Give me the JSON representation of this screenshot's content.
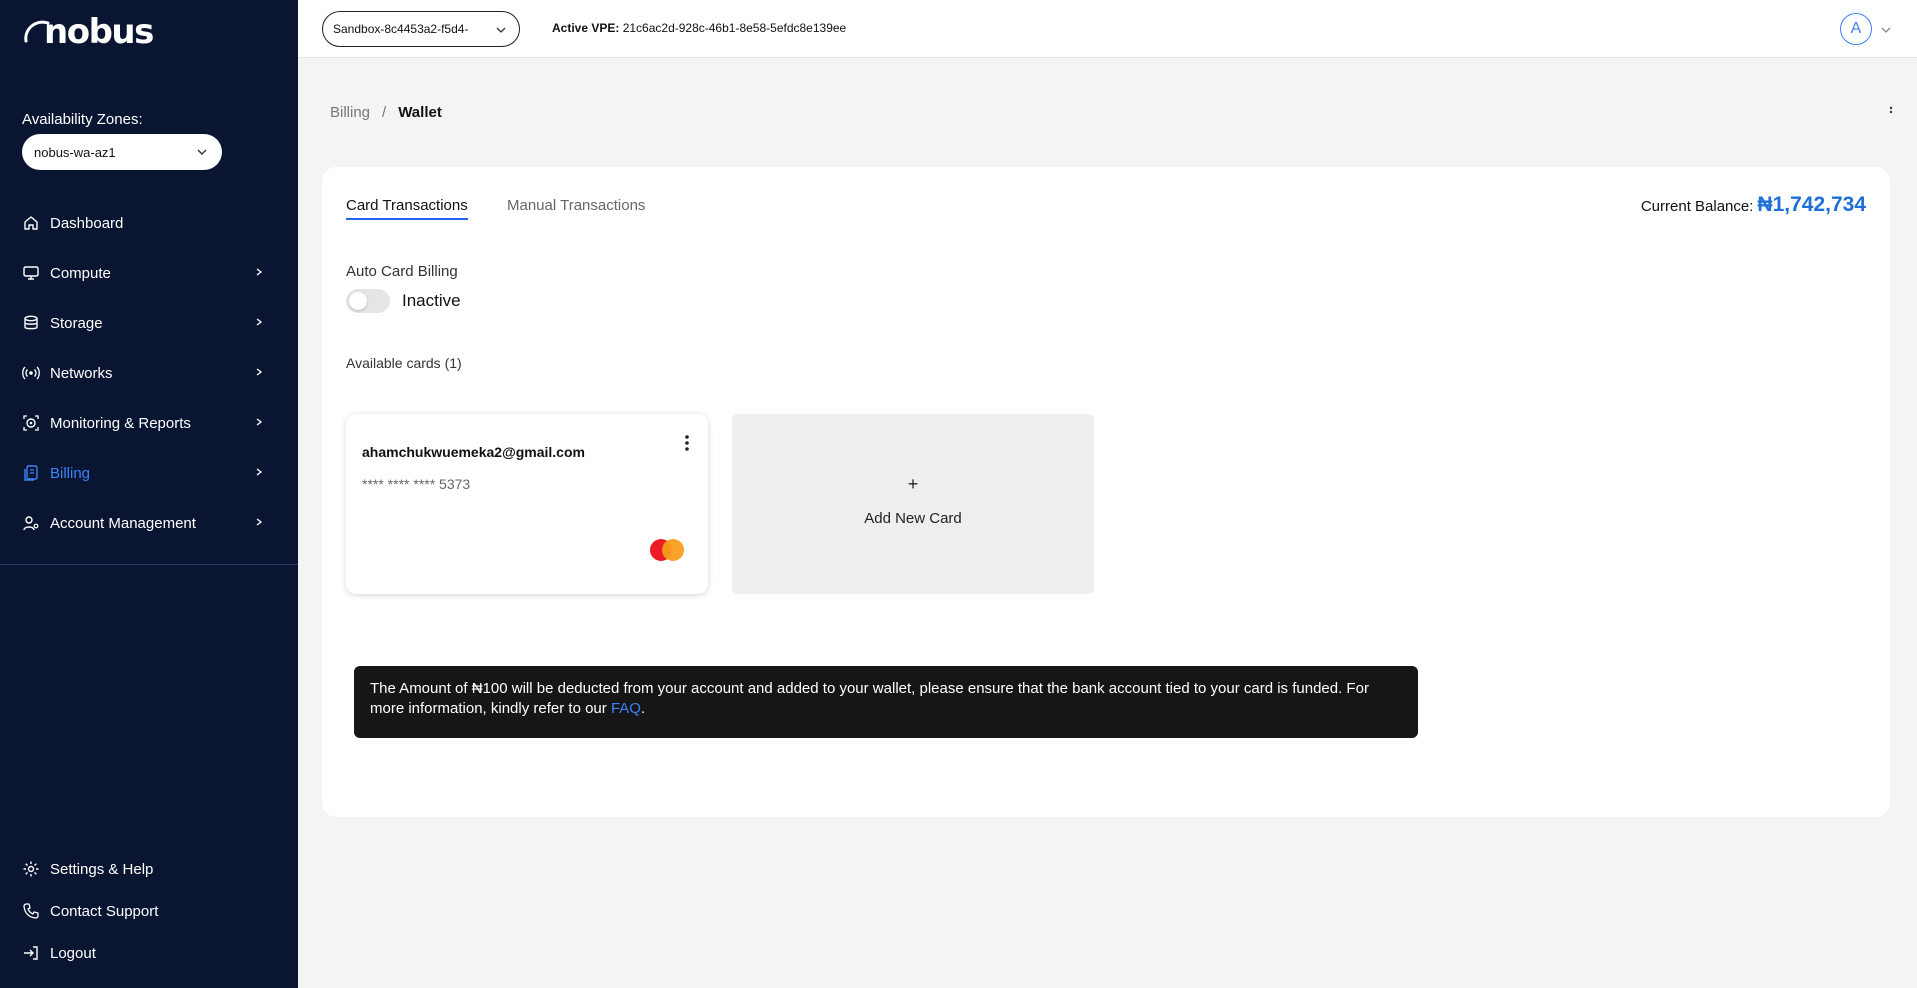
{
  "brand": {
    "name": "nobus"
  },
  "sidebar": {
    "az_label": "Availability Zones:",
    "az_value": "nobus-wa-az1",
    "items": [
      {
        "label": "Dashboard",
        "icon": "home-icon"
      },
      {
        "label": "Compute",
        "icon": "monitor-icon"
      },
      {
        "label": "Storage",
        "icon": "database-icon"
      },
      {
        "label": "Networks",
        "icon": "network-icon"
      },
      {
        "label": "Monitoring & Reports",
        "icon": "monitoring-icon"
      },
      {
        "label": "Billing",
        "icon": "billing-icon"
      },
      {
        "label": "Account Management",
        "icon": "user-settings-icon"
      }
    ],
    "bottom_items": [
      {
        "label": "Settings & Help",
        "icon": "gear-icon"
      },
      {
        "label": "Contact Support",
        "icon": "phone-icon"
      },
      {
        "label": "Logout",
        "icon": "logout-icon"
      }
    ]
  },
  "topbar": {
    "vpe_select": "Sandbox-8c4453a2-f5d4-",
    "active_vpe_label": "Active VPE:",
    "active_vpe_value": "21c6ac2d-928c-46b1-8e58-5efdc8e139ee",
    "avatar_initial": "A"
  },
  "breadcrumb": {
    "parent": "Billing",
    "separator": "/",
    "current": "Wallet"
  },
  "wallet": {
    "tabs": [
      "Card Transactions",
      "Manual Transactions"
    ],
    "balance_label": "Current Balance:",
    "balance_value": "₦1,742,734",
    "auto_billing_label": "Auto Card Billing",
    "auto_billing_state": "Inactive",
    "available_cards_label": "Available cards (1)",
    "card": {
      "email": "ahamchukwuemeka2@gmail.com",
      "number": "**** **** **** 5373"
    },
    "add_card_label": "Add New Card",
    "notice_text": "The Amount of ₦100 will be deducted from your account and added to your wallet, please ensure that the bank account tied to your card is funded. For more information, kindly refer to our ",
    "notice_link": "FAQ",
    "notice_end": "."
  },
  "colors": {
    "sidebar_bg": "#0a1532",
    "accent": "#3b82f6",
    "balance": "#1e6fd9",
    "notice_bg": "#161616"
  }
}
